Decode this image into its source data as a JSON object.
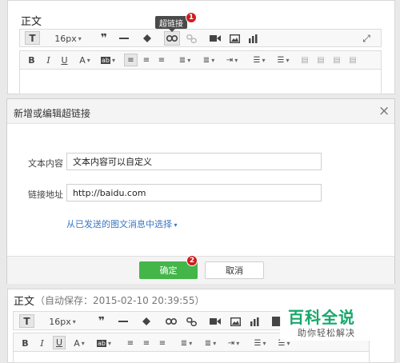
{
  "editor_top": {
    "title": "正文",
    "font_size": "16px",
    "tooltip": "超链接",
    "badge1": "1"
  },
  "dialog": {
    "title": "新增或编辑超链接",
    "close": "×",
    "text_label": "文本内容",
    "text_value": "文本内容可以自定义",
    "url_label": "链接地址",
    "url_value": "http://baidu.com",
    "select_link": "从已发送的图文消息中选择",
    "ok_label": "确定",
    "cancel_label": "取消",
    "badge2": "2"
  },
  "editor_bottom": {
    "title": "正文",
    "autosave": "（自动保存：2015-02-10 20:39:55）",
    "font_size": "16px"
  },
  "watermark": {
    "main": "百科全说",
    "sub": "助你轻松解决"
  },
  "colors": {
    "ok_green": "#44b549",
    "badge_red": "#cc1e1e",
    "link_blue": "#3a76c4",
    "watermark_green": "#17a86b"
  }
}
